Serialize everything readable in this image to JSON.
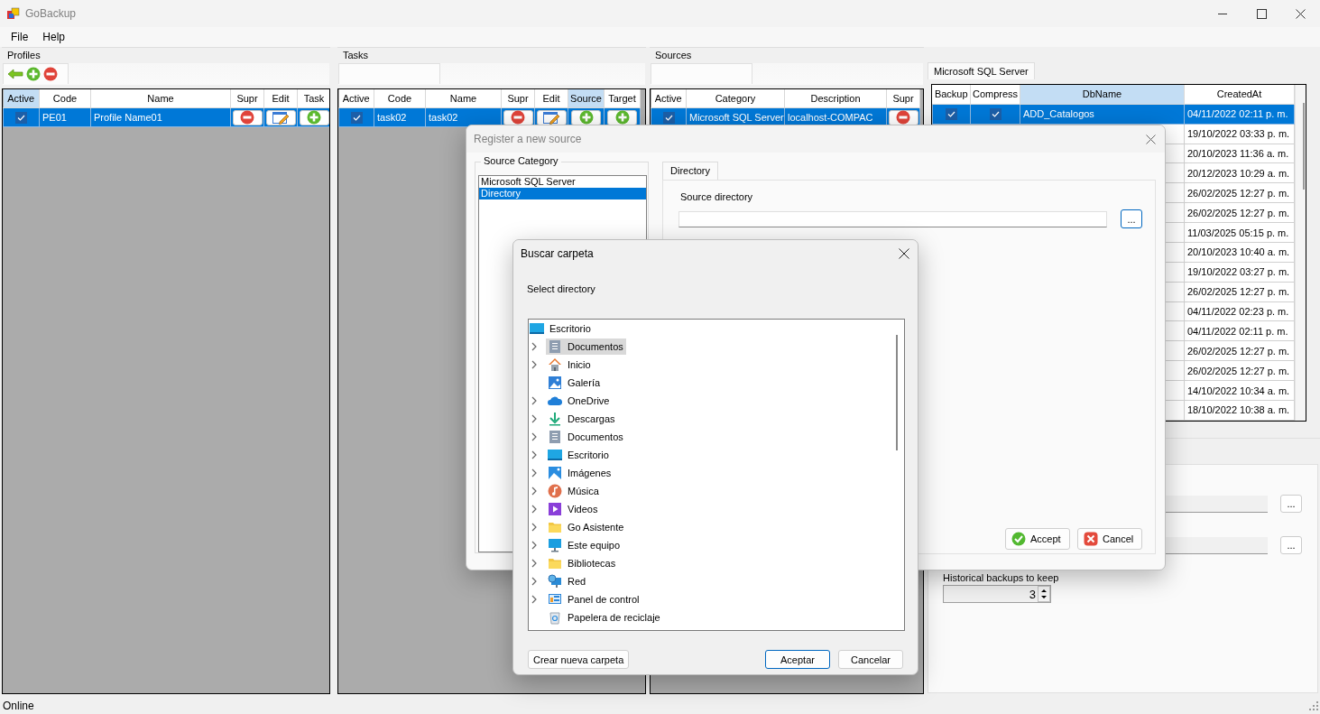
{
  "window": {
    "title": "GoBackup"
  },
  "menu": [
    "File",
    "Help"
  ],
  "profiles": {
    "title": "Profiles",
    "columns": [
      {
        "label": "Active",
        "selected": true
      },
      {
        "label": "Code",
        "selected": false
      },
      {
        "label": "Name",
        "selected": false
      },
      {
        "label": "Supr",
        "selected": false
      },
      {
        "label": "Edit",
        "selected": false
      },
      {
        "label": "Task",
        "selected": false
      }
    ],
    "rows": [
      {
        "selected": true,
        "active": true,
        "code": "PE01",
        "name": "Profile Name01"
      }
    ]
  },
  "tasks": {
    "title": "Tasks",
    "columns": [
      {
        "label": "Active",
        "selected": false
      },
      {
        "label": "Code",
        "selected": false
      },
      {
        "label": "Name",
        "selected": false
      },
      {
        "label": "Supr",
        "selected": false
      },
      {
        "label": "Edit",
        "selected": false
      },
      {
        "label": "Source",
        "selected": true
      },
      {
        "label": "Target",
        "selected": false
      }
    ],
    "rows": [
      {
        "selected": true,
        "active": true,
        "code": "task02",
        "name": "task02"
      }
    ]
  },
  "sources": {
    "title": "Sources",
    "columns": [
      {
        "label": "Active",
        "selected": false
      },
      {
        "label": "Category",
        "selected": false
      },
      {
        "label": "Description",
        "selected": false
      },
      {
        "label": "Supr",
        "selected": false
      }
    ],
    "rows": [
      {
        "selected": true,
        "active": true,
        "category": "Microsoft SQL Server",
        "description": "localhost-COMPAC"
      }
    ]
  },
  "databases": {
    "tab": "Microsoft SQL Server",
    "columns": [
      {
        "label": "Backup",
        "selected": false
      },
      {
        "label": "Compress",
        "selected": false
      },
      {
        "label": "DbName",
        "selected": true
      },
      {
        "label": "CreatedAt",
        "selected": false
      }
    ],
    "rows": [
      {
        "selected": true,
        "backup": true,
        "compress": true,
        "db_name": "ADD_Catalogos",
        "created_at": "04/11/2022 02:11 p. m."
      },
      {
        "selected": false,
        "created_at": "19/10/2022 03:33 p. m."
      },
      {
        "selected": false,
        "created_at": "20/10/2023 11:36 a. m."
      },
      {
        "selected": false,
        "created_at": "20/12/2023 10:29 a. m."
      },
      {
        "selected": false,
        "created_at": "26/02/2025 12:27 p. m."
      },
      {
        "selected": false,
        "created_at": "26/02/2025 12:27 p. m."
      },
      {
        "selected": false,
        "created_at": "11/03/2025 05:15 p. m."
      },
      {
        "selected": false,
        "created_at": "20/10/2023 10:40 a. m."
      },
      {
        "selected": false,
        "created_at": "19/10/2022 03:27 p. m."
      },
      {
        "selected": false,
        "created_at": "26/02/2025 12:27 p. m."
      },
      {
        "selected": false,
        "created_at": "04/11/2022 02:23 p. m."
      },
      {
        "selected": false,
        "created_at": "04/11/2022 02:11 p. m."
      },
      {
        "selected": false,
        "created_at": "26/02/2025 12:27 p. m."
      },
      {
        "selected": false,
        "created_at": "26/02/2025 12:27 p. m."
      },
      {
        "selected": false,
        "created_at": "14/10/2022 10:34 a. m."
      },
      {
        "selected": false,
        "created_at": "18/10/2022 10:38 a. m."
      }
    ]
  },
  "settings": {
    "browse_buttons": [
      "...",
      "..."
    ],
    "history_label": "Historical backups to keep",
    "history_value": "3"
  },
  "register_dialog": {
    "title": "Register a new source",
    "category_group": {
      "title": "Source Category",
      "items": [
        {
          "label": "Microsoft SQL Server",
          "selected": false
        },
        {
          "label": "Directory",
          "selected": true
        }
      ]
    },
    "tabs": [
      {
        "label": "Directory",
        "selected": true
      }
    ],
    "source_directory": {
      "label": "Source directory",
      "browse": "..."
    },
    "buttons": [
      {
        "label": "Accept",
        "kind": "accept"
      },
      {
        "label": "Cancel",
        "kind": "cancel"
      }
    ]
  },
  "folder_dialog": {
    "title": "Buscar carpeta",
    "prompt": "Select directory",
    "tree": {
      "label": "Escritorio",
      "kind": "desktop",
      "children": [
        {
          "label": "Documentos",
          "kind": "documents",
          "expandable": true,
          "selected": true
        },
        {
          "label": "Inicio",
          "kind": "home",
          "expandable": true,
          "selected": false
        },
        {
          "label": "Galería",
          "kind": "gallery",
          "expandable": false,
          "selected": false
        },
        {
          "label": "OneDrive",
          "kind": "cloud",
          "expandable": true,
          "selected": false
        },
        {
          "label": "Descargas",
          "kind": "download",
          "expandable": true,
          "selected": false
        },
        {
          "label": "Documentos",
          "kind": "documents",
          "expandable": true,
          "selected": false
        },
        {
          "label": "Escritorio",
          "kind": "desktop",
          "expandable": true,
          "selected": false
        },
        {
          "label": "Imágenes",
          "kind": "pictures",
          "expandable": true,
          "selected": false
        },
        {
          "label": "Música",
          "kind": "music",
          "expandable": true,
          "selected": false
        },
        {
          "label": "Videos",
          "kind": "videos",
          "expandable": true,
          "selected": false
        },
        {
          "label": "Go Asistente",
          "kind": "folder",
          "expandable": true,
          "selected": false
        },
        {
          "label": "Este equipo",
          "kind": "computer",
          "expandable": true,
          "selected": false
        },
        {
          "label": "Bibliotecas",
          "kind": "folder",
          "expandable": true,
          "selected": false
        },
        {
          "label": "Red",
          "kind": "network",
          "expandable": true,
          "selected": false
        },
        {
          "label": "Panel de control",
          "kind": "control-panel",
          "expandable": true,
          "selected": false
        },
        {
          "label": "Papelera de reciclaje",
          "kind": "recycle-bin",
          "expandable": false,
          "selected": false
        }
      ]
    },
    "buttons": [
      {
        "label": "Crear nueva carpeta",
        "default": false
      },
      {
        "label": "Aceptar",
        "default": true
      },
      {
        "label": "Cancelar",
        "default": false
      }
    ]
  },
  "status_bar": {
    "text": "Online"
  }
}
